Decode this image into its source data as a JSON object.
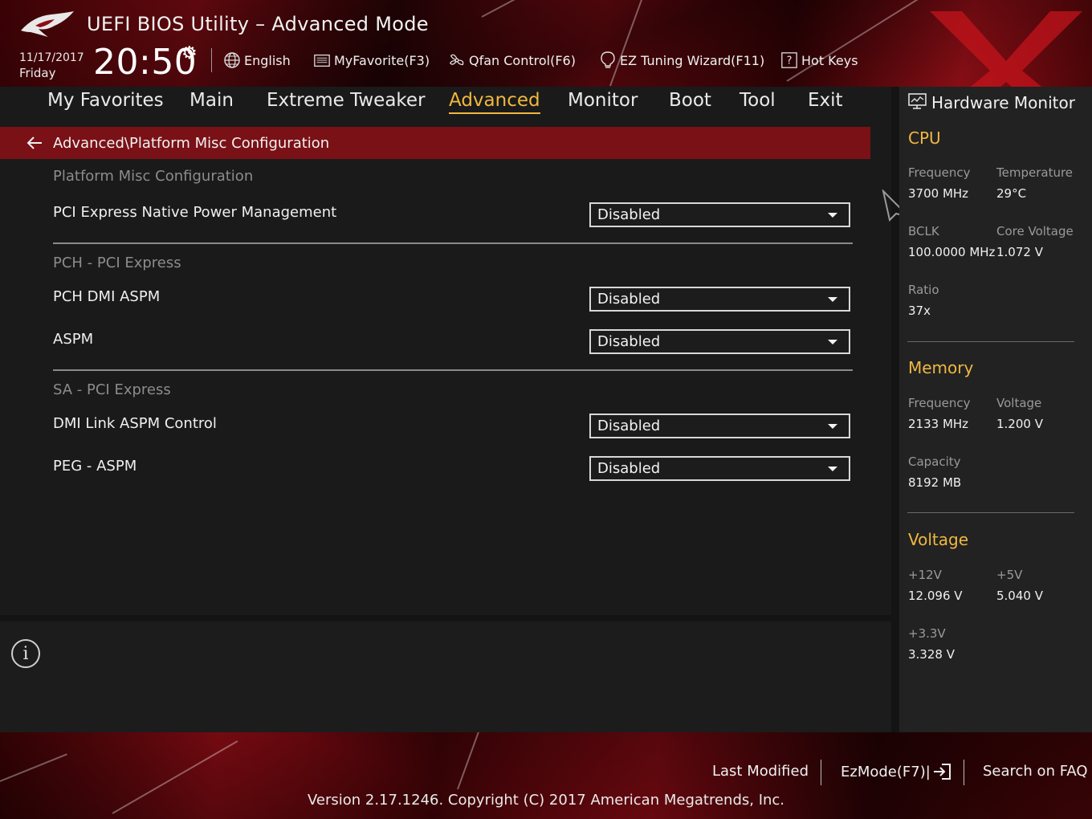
{
  "header": {
    "title": "UEFI BIOS Utility – Advanced Mode",
    "date": "11/17/2017",
    "day": "Friday",
    "time": "20:50",
    "toolbar": {
      "language": "English",
      "my_favorite": "MyFavorite(F3)",
      "qfan": "Qfan Control(F6)",
      "ez_tuning": "EZ Tuning Wizard(F11)",
      "hot_keys": "Hot Keys"
    }
  },
  "tabs": [
    {
      "label": "My Favorites",
      "active": false
    },
    {
      "label": "Main",
      "active": false
    },
    {
      "label": "Extreme Tweaker",
      "active": false
    },
    {
      "label": "Advanced",
      "active": true
    },
    {
      "label": "Monitor",
      "active": false
    },
    {
      "label": "Boot",
      "active": false
    },
    {
      "label": "Tool",
      "active": false
    },
    {
      "label": "Exit",
      "active": false
    }
  ],
  "breadcrumb": "Advanced\\Platform Misc Configuration",
  "sections": {
    "platform": {
      "title": "Platform Misc Configuration",
      "items": [
        {
          "label": "PCI Express Native Power Management",
          "value": "Disabled"
        }
      ]
    },
    "pch": {
      "title": "PCH - PCI Express",
      "items": [
        {
          "label": "PCH DMI ASPM",
          "value": "Disabled"
        },
        {
          "label": "ASPM",
          "value": "Disabled"
        }
      ]
    },
    "sa": {
      "title": "SA - PCI Express",
      "items": [
        {
          "label": "DMI Link ASPM Control",
          "value": "Disabled"
        },
        {
          "label": "PEG - ASPM",
          "value": "Disabled"
        }
      ]
    }
  },
  "hw_monitor": {
    "title": "Hardware Monitor",
    "cpu": {
      "heading": "CPU",
      "frequency_label": "Frequency",
      "frequency": "3700 MHz",
      "temperature_label": "Temperature",
      "temperature": "29°C",
      "bclk_label": "BCLK",
      "bclk": "100.0000 MHz",
      "core_voltage_label": "Core Voltage",
      "core_voltage": "1.072 V",
      "ratio_label": "Ratio",
      "ratio": "37x"
    },
    "memory": {
      "heading": "Memory",
      "frequency_label": "Frequency",
      "frequency": "2133 MHz",
      "voltage_label": "Voltage",
      "voltage": "1.200 V",
      "capacity_label": "Capacity",
      "capacity": "8192 MB"
    },
    "voltage": {
      "heading": "Voltage",
      "v12_label": "+12V",
      "v12": "12.096 V",
      "v5_label": "+5V",
      "v5": "5.040 V",
      "v33_label": "+3.3V",
      "v33": "3.328 V"
    }
  },
  "footer": {
    "last_modified": "Last Modified",
    "ezmode": "EzMode(F7)|",
    "search_faq": "Search on FAQ",
    "version": "Version 2.17.1246. Copyright (C) 2017 American Megatrends, Inc."
  },
  "colors": {
    "accent": "#f0b840",
    "breadcrumb_bar": "#7a1116",
    "header_red": "#8c0c14"
  }
}
